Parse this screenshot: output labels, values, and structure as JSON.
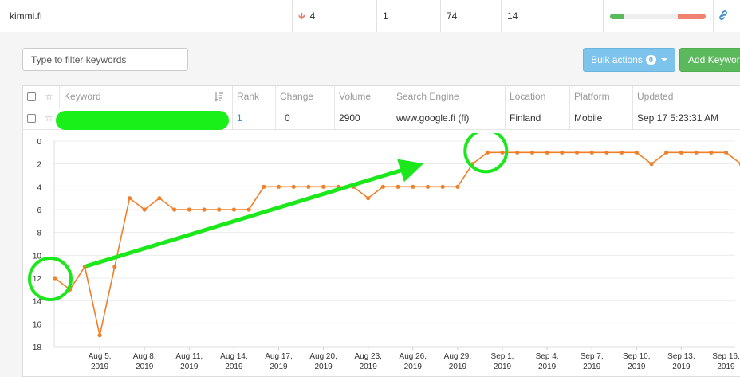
{
  "top_row": {
    "domain": "kimmi.fi",
    "change": "4",
    "col3": "1",
    "col4": "74",
    "col5": "14"
  },
  "toolbar": {
    "filter_placeholder": "Type to filter keywords",
    "bulk_label": "Bulk actions",
    "bulk_count": "0",
    "add_label": "Add Keyword"
  },
  "table": {
    "headers": [
      "Keyword",
      "Rank",
      "Change",
      "Volume",
      "Search Engine",
      "Location",
      "Platform",
      "Updated"
    ],
    "row": {
      "rank": "1",
      "change": "0",
      "volume": "2900",
      "engine": "www.google.fi (fi)",
      "location": "Finland",
      "platform": "Mobile",
      "updated": "Sep 17 5:23:31 AM"
    }
  },
  "colors": {
    "series": "#f07f2a",
    "annotation": "#1be81b",
    "primary": "#7dc3ec",
    "success": "#5cb85c"
  },
  "chart_data": {
    "type": "line",
    "y_reversed": true,
    "ylim": [
      0,
      18
    ],
    "yticks": [
      "0",
      "2",
      "4",
      "6",
      "8",
      "10",
      "12",
      "14",
      "16",
      "18"
    ],
    "xticks": [
      [
        "Aug 5,",
        "2019"
      ],
      [
        "Aug 8,",
        "2019"
      ],
      [
        "Aug 11,",
        "2019"
      ],
      [
        "Aug 14,",
        "2019"
      ],
      [
        "Aug 17,",
        "2019"
      ],
      [
        "Aug 20,",
        "2019"
      ],
      [
        "Aug 23,",
        "2019"
      ],
      [
        "Aug 26,",
        "2019"
      ],
      [
        "Aug 29,",
        "2019"
      ],
      [
        "Sep 1,",
        "2019"
      ],
      [
        "Sep 4,",
        "2019"
      ],
      [
        "Sep 7,",
        "2019"
      ],
      [
        "Sep 10,",
        "2019"
      ],
      [
        "Sep 13,",
        "2019"
      ],
      [
        "Sep 16,",
        "2019"
      ]
    ],
    "x_start": "Aug 3, 2019",
    "series": [
      {
        "values": [
          12,
          13,
          11,
          17,
          11,
          5,
          6,
          5,
          6,
          6,
          6,
          6,
          6,
          6,
          4,
          4,
          4,
          4,
          4,
          4,
          4,
          5,
          4,
          4,
          4,
          4,
          4,
          4,
          2,
          1,
          1,
          1,
          1,
          1,
          1,
          1,
          1,
          1,
          1,
          1,
          2,
          1,
          1,
          1,
          1,
          1,
          2,
          1,
          1
        ]
      }
    ]
  }
}
